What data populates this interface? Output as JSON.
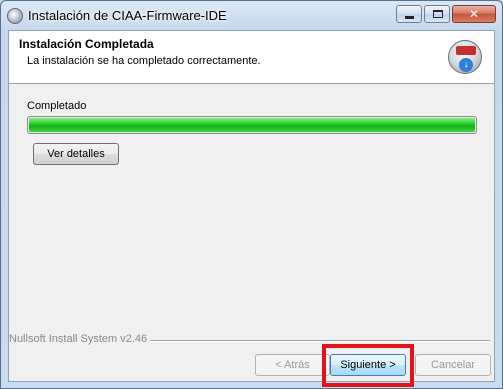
{
  "window": {
    "title": "Instalación de CIAA-Firmware-IDE"
  },
  "caption_buttons": {
    "minimize_icon": "minimize-icon",
    "maximize_icon": "maximize-icon",
    "close_icon": "close-icon"
  },
  "header": {
    "title": "Instalación Completada",
    "subtitle": "La instalación se ha completado correctamente.",
    "logo_icon": "installer-logo-icon"
  },
  "progress": {
    "label": "Completado",
    "value_percent": 100,
    "color": "#22c322"
  },
  "buttons": {
    "details": "Ver detalles",
    "back": "< Atrás",
    "next": "Siguiente >",
    "cancel": "Cancelar"
  },
  "footer": {
    "brand": "Nullsoft Install System v2.46"
  },
  "highlight_color": "#e3131b"
}
